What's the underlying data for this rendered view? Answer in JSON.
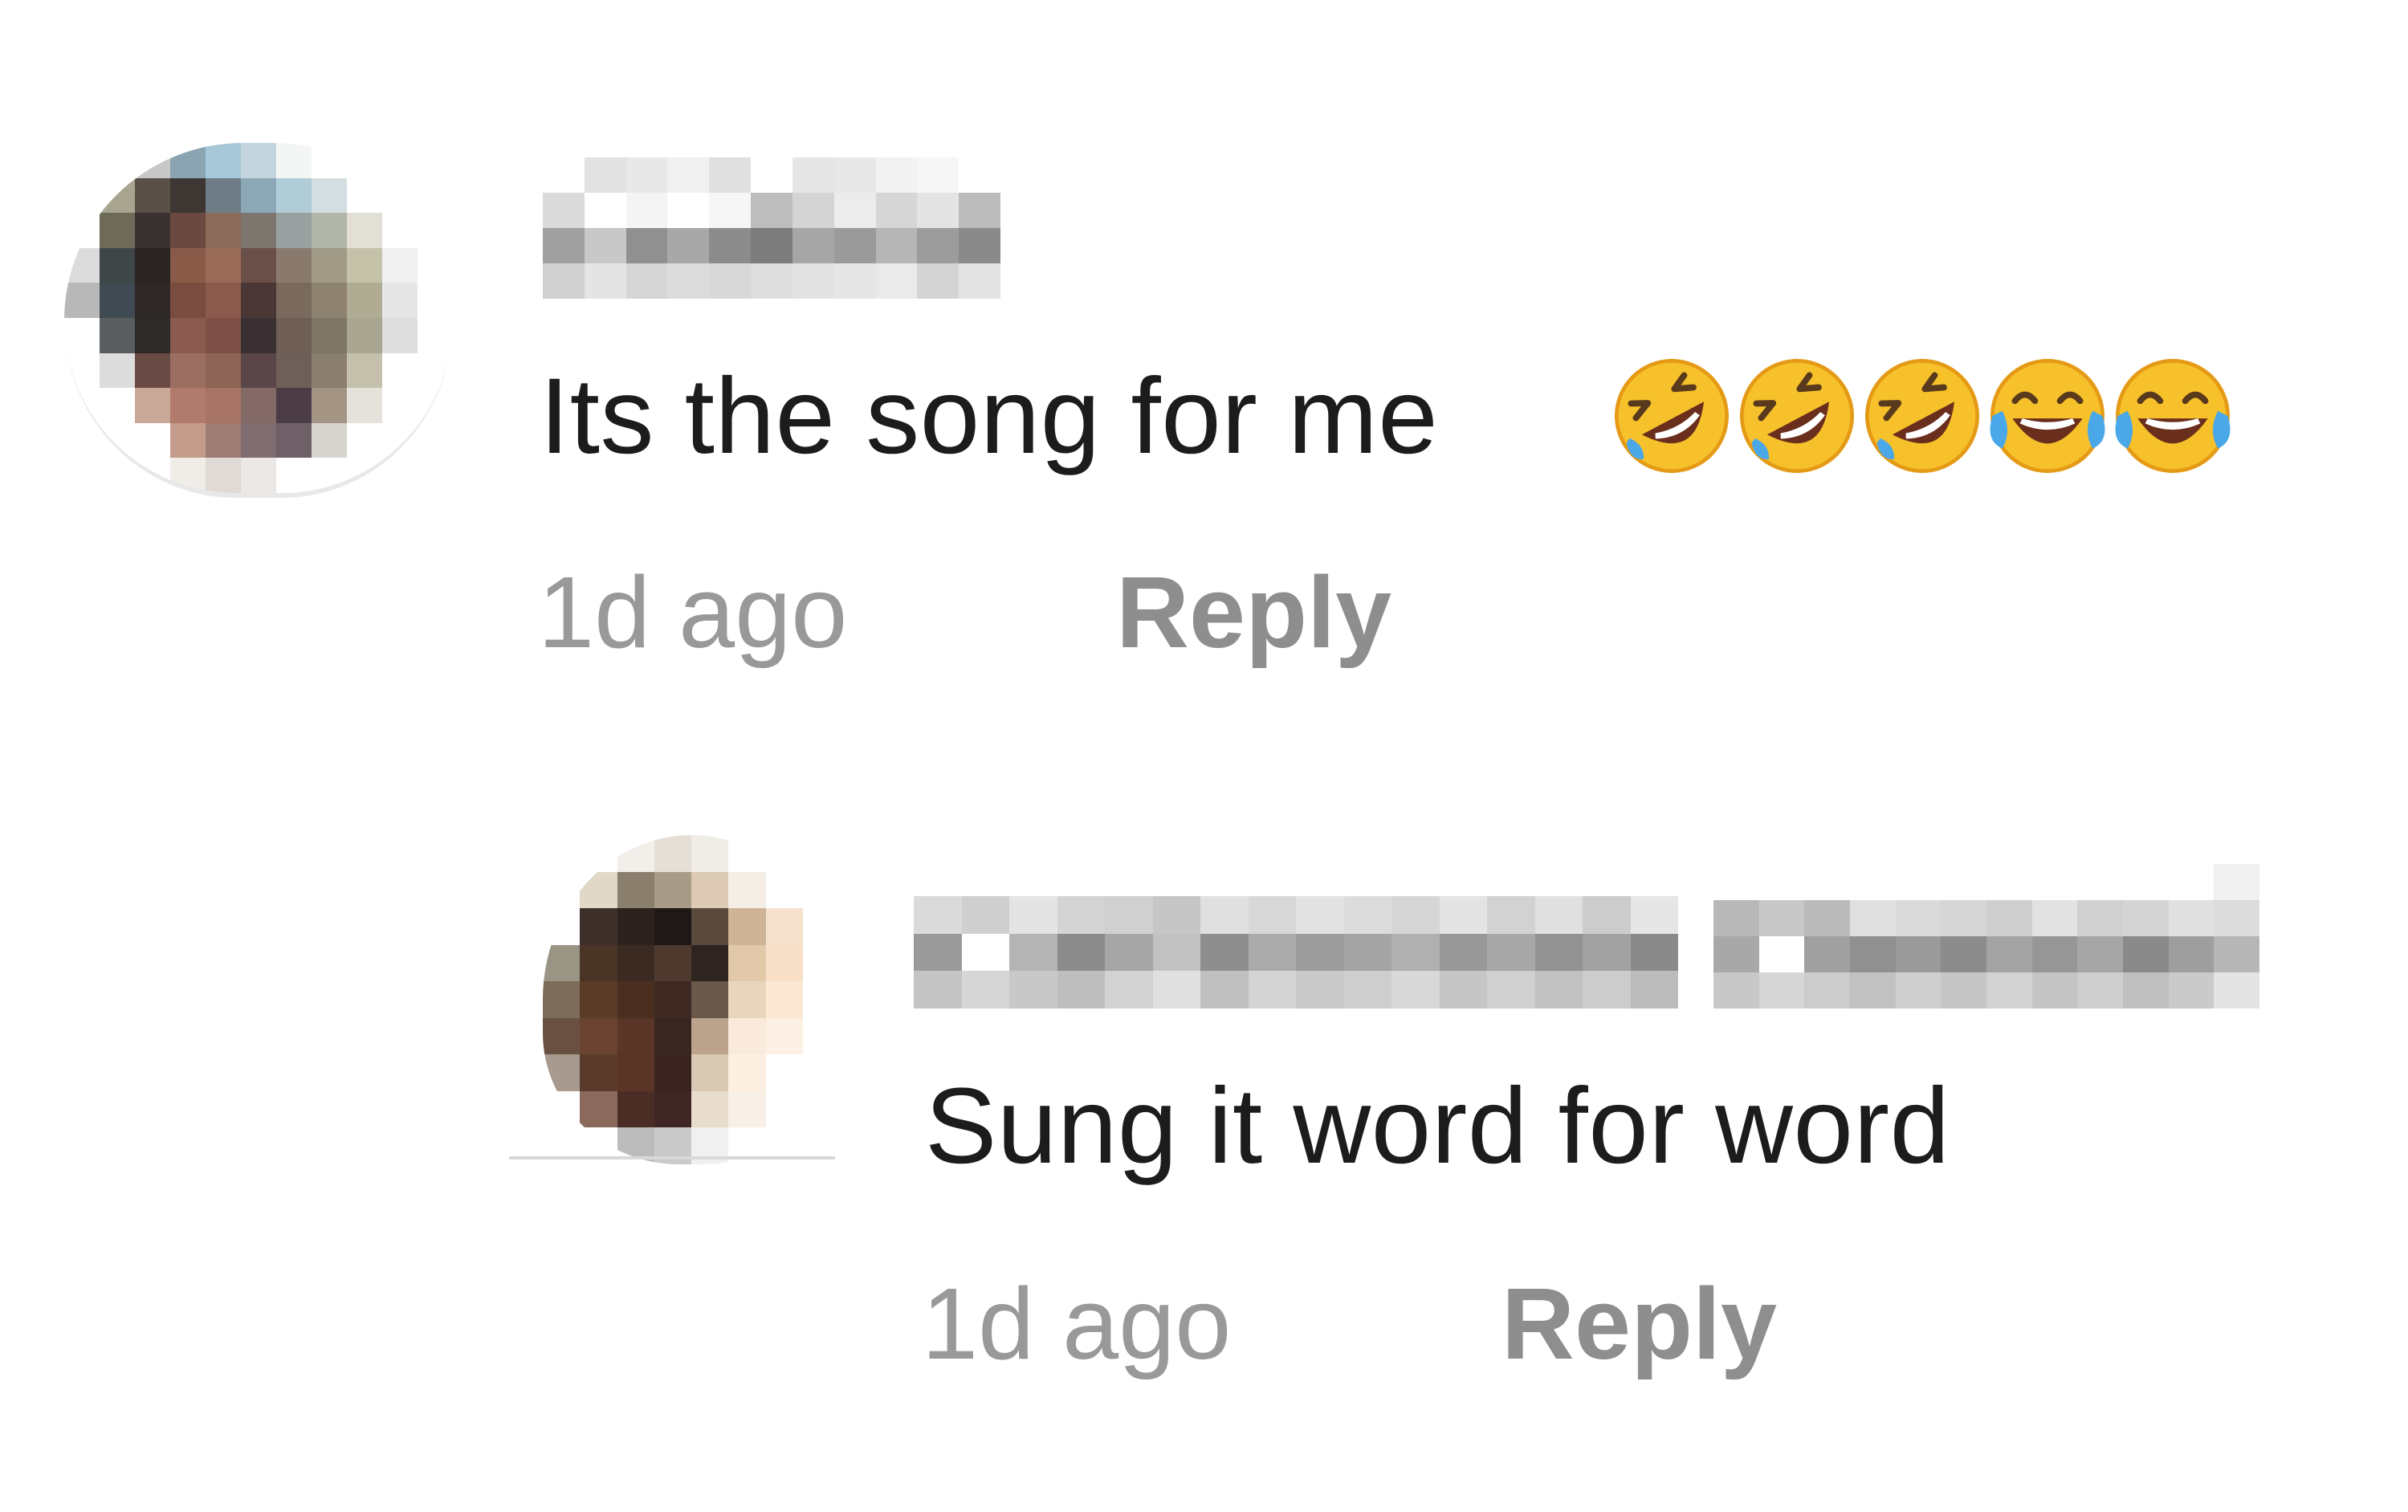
{
  "comments": [
    {
      "text": "Its the song for me",
      "emojis": [
        "rolling-on-floor-laughing",
        "rolling-on-floor-laughing",
        "rolling-on-floor-laughing",
        "face-with-tears-of-joy",
        "face-with-tears-of-joy"
      ],
      "time": "1d ago",
      "reply_label": "Reply",
      "avatar_colors": [
        [
          "#ffffff",
          "#ffffff",
          "#c8c8c8",
          "#8aa4b2",
          "#a6c8d8",
          "#c4d4de",
          "#f4f6f6",
          "#ffffff",
          "#ffffff",
          "#ffffff",
          "#ffffff"
        ],
        [
          "#ffffff",
          "#a7a48f",
          "#5a5048",
          "#3e3632",
          "#6e7c86",
          "#8ca8b6",
          "#b0ccd6",
          "#d4dde0",
          "#ffffff",
          "#ffffff",
          "#ffffff"
        ],
        [
          "#ffffff",
          "#6e6a58",
          "#3a3230",
          "#6a4a40",
          "#8a6a5a",
          "#7c766e",
          "#98a0a0",
          "#b2b6a8",
          "#e2e0d6",
          "#ffffff",
          "#ffffff"
        ],
        [
          "#dcdcdc",
          "#3e4648",
          "#2a2422",
          "#8a5a48",
          "#9a6a58",
          "#6a5048",
          "#8a7a6e",
          "#a09a86",
          "#c4c2a8",
          "#f0f0f0",
          "#ffffff"
        ],
        [
          "#b8b8b8",
          "#404a52",
          "#2e2828",
          "#7a4c40",
          "#8c5a4c",
          "#4a3634",
          "#7a6a5e",
          "#8e8270",
          "#b0ac94",
          "#e6e6e6",
          "#ffffff"
        ],
        [
          "#ffffff",
          "#5a5e60",
          "#2e2a28",
          "#8a5a4e",
          "#7c5046",
          "#3a3034",
          "#6e5e56",
          "#7e7664",
          "#a8a690",
          "#dedede",
          "#ffffff"
        ],
        [
          "#ffffff",
          "#dcdcdc",
          "#6a4a44",
          "#9a6e60",
          "#8e6456",
          "#5a4648",
          "#6e6058",
          "#8a7e6e",
          "#c4c0ac",
          "#ffffff",
          "#ffffff"
        ],
        [
          "#ffffff",
          "#ffffff",
          "#caa898",
          "#b07a6c",
          "#a87466",
          "#846a66",
          "#4c3c46",
          "#a49484",
          "#e4e2da",
          "#ffffff",
          "#ffffff"
        ],
        [
          "#ffffff",
          "#ffffff",
          "#ffffff",
          "#c49c8c",
          "#a07c76",
          "#7e6c70",
          "#6e6066",
          "#d8d4d0",
          "#ffffff",
          "#ffffff",
          "#ffffff"
        ],
        [
          "#ffffff",
          "#ffffff",
          "#ffffff",
          "#f0ece8",
          "#e0dad6",
          "#ece8e6",
          "#ffffff",
          "#ffffff",
          "#ffffff",
          "#ffffff",
          "#ffffff"
        ]
      ],
      "username_colors": [
        [
          "#ffffff",
          "#e2e2e2",
          "#e8e8e8",
          "#f0f0f0",
          "#e0e0e0",
          "#ffffff",
          "#e6e6e6",
          "#e8e8e8",
          "#f2f2f2",
          "#f6f6f6",
          "#ffffff"
        ],
        [
          "#dadada",
          "#ffffff",
          "#f4f4f4",
          "#ffffff",
          "#f6f6f6",
          "#bdbdbd",
          "#d4d4d4",
          "#ececec",
          "#d6d6d6",
          "#e4e4e4",
          "#bcbcbc"
        ],
        [
          "#a0a0a0",
          "#c8c8c8",
          "#909090",
          "#a8a8a8",
          "#8c8c8c",
          "#7c7c7c",
          "#a6a6a6",
          "#9a9a9a",
          "#b6b6b6",
          "#9c9c9c",
          "#8a8a8a"
        ],
        [
          "#d0d0d0",
          "#e4e4e4",
          "#d6d6d6",
          "#dcdcdc",
          "#d8d8d8",
          "#dedede",
          "#e2e2e2",
          "#e6e6e6",
          "#eaeaea",
          "#d4d4d4",
          "#e4e4e4"
        ]
      ]
    },
    {
      "text": "Sung it word for word",
      "time": "1d ago",
      "reply_label": "Reply",
      "avatar_colors": [
        [
          "#ffffff",
          "#ffffff",
          "#f2efea",
          "#e6dfd6",
          "#f0ece6",
          "#ffffff",
          "#ffffff",
          "#ffffff"
        ],
        [
          "#ffffff",
          "#e2d8c8",
          "#8a7e6c",
          "#a89c88",
          "#dccab4",
          "#f4eee6",
          "#ffffff",
          "#ffffff"
        ],
        [
          "#ffffff",
          "#3e302a",
          "#2e221e",
          "#1e1816",
          "#5a4a3c",
          "#cfb496",
          "#f6e2cc",
          "#ffffff"
        ],
        [
          "#9a9484",
          "#4a3426",
          "#3a2a22",
          "#4e3a2e",
          "#2e2420",
          "#e0c8a8",
          "#f8e0c8",
          "#ffffff"
        ],
        [
          "#7e6c5a",
          "#5a3c28",
          "#4a2e20",
          "#3e2a22",
          "#6a584a",
          "#e8d6bc",
          "#fbe8d4",
          "#ffffff"
        ],
        [
          "#6a5040",
          "#6a4430",
          "#5a3628",
          "#3a2620",
          "#bca48c",
          "#faeadc",
          "#fdf0e4",
          "#ffffff"
        ],
        [
          "#a89a8e",
          "#5a3a2a",
          "#5a3426",
          "#3a2420",
          "#d8c8b4",
          "#fcefe2",
          "#ffffff",
          "#ffffff"
        ],
        [
          "#ffffff",
          "#8a6a5c",
          "#4a2e26",
          "#3e2624",
          "#e8dccc",
          "#f8f0e6",
          "#ffffff",
          "#ffffff"
        ],
        [
          "#ffffff",
          "#ffffff",
          "#bcbcbc",
          "#cacaca",
          "#f0f0f0",
          "#ffffff",
          "#ffffff",
          "#ffffff"
        ]
      ],
      "username_a_colors": [
        [
          "#dadada",
          "#cfcfcf",
          "#e4e4e4",
          "#d4d4d4",
          "#d0d0d0",
          "#c6c6c6",
          "#e0e0e0",
          "#d8d8d8",
          "#e2e2e2",
          "#dcdcdc",
          "#d6d6d6",
          "#e4e4e4",
          "#d2d2d2",
          "#e0e0e0",
          "#cccccc",
          "#e6e6e6"
        ],
        [
          "#9a9a9a",
          "#ffffff",
          "#b4b4b4",
          "#8c8c8c",
          "#a6a6a6",
          "#c2c2c2",
          "#8e8e8e",
          "#ababab",
          "#9c9c9c",
          "#a4a4a4",
          "#b0b0b0",
          "#989898",
          "#a8a8a8",
          "#929292",
          "#a2a2a2",
          "#8a8a8a"
        ],
        [
          "#c4c4c4",
          "#d6d6d6",
          "#c8c8c8",
          "#bebebe",
          "#d2d2d2",
          "#e0e0e0",
          "#c0c0c0",
          "#d4d4d4",
          "#cacaca",
          "#cecece",
          "#d8d8d8",
          "#c6c6c6",
          "#d0d0d0",
          "#c2c2c2",
          "#cccccc",
          "#bcbcbc"
        ]
      ],
      "username_b_colors": [
        [
          "#ffffff",
          "#ffffff",
          "#ffffff",
          "#ffffff",
          "#ffffff",
          "#ffffff",
          "#ffffff",
          "#ffffff",
          "#ffffff",
          "#ffffff",
          "#ffffff",
          "#f0f0f0"
        ],
        [
          "#b8b8b8",
          "#c8c8c8",
          "#bababa",
          "#e0e0e0",
          "#dadada",
          "#d6d6d6",
          "#cfcfcf",
          "#e2e2e2",
          "#d0d0d0",
          "#d4d4d4",
          "#e0e0e0",
          "#dcdcdc"
        ],
        [
          "#a8a8a8",
          "#ffffff",
          "#a0a0a0",
          "#909090",
          "#9a9a9a",
          "#8c8c8c",
          "#a4a4a4",
          "#969696",
          "#a6a6a6",
          "#8a8a8a",
          "#9e9e9e",
          "#b6b6b6"
        ],
        [
          "#c8c8c8",
          "#d6d6d6",
          "#cccccc",
          "#c2c2c2",
          "#cfcfcf",
          "#c6c6c6",
          "#d2d2d2",
          "#c4c4c4",
          "#cecece",
          "#c0c0c0",
          "#cacaca",
          "#e4e4e4"
        ]
      ]
    }
  ]
}
